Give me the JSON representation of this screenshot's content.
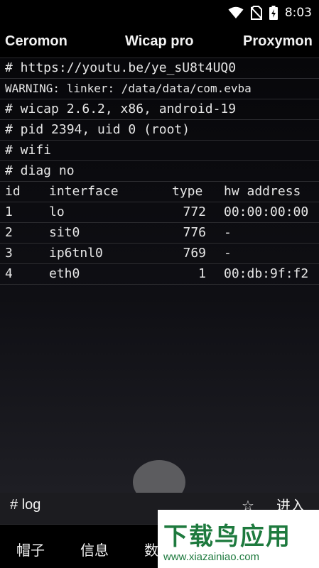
{
  "status_bar": {
    "time": "8:03",
    "icons": [
      "wifi-icon",
      "no-sim-icon",
      "battery-charging-icon"
    ]
  },
  "header": {
    "left": "Ceromon",
    "center": "Wicap pro",
    "right": "Proxymon"
  },
  "console": {
    "lines": [
      "# https://youtu.be/ye_sU8t4UQ0",
      "WARNING: linker: /data/data/com.evba",
      "# wicap 2.6.2, x86, android-19",
      "# pid 2394, uid 0 (root)",
      "# wifi",
      "# diag no"
    ],
    "table": {
      "headers": [
        "id",
        "interface",
        "type",
        "hw address"
      ],
      "rows": [
        [
          "1",
          "lo",
          "772",
          "00:00:00:00"
        ],
        [
          "2",
          "sit0",
          "776",
          "-"
        ],
        [
          "3",
          "ip6tnl0",
          "769",
          "-"
        ],
        [
          "4",
          "eth0",
          "1",
          "00:db:9f:f2"
        ]
      ]
    }
  },
  "bottom_row": {
    "log_label": "# log",
    "star_icon": "star-icon",
    "enter_label": "进入"
  },
  "tabs": [
    "帽子",
    "信息",
    "数"
  ],
  "watermark": {
    "title": "下载鸟应用",
    "url": "www.xiazainiao.com"
  }
}
